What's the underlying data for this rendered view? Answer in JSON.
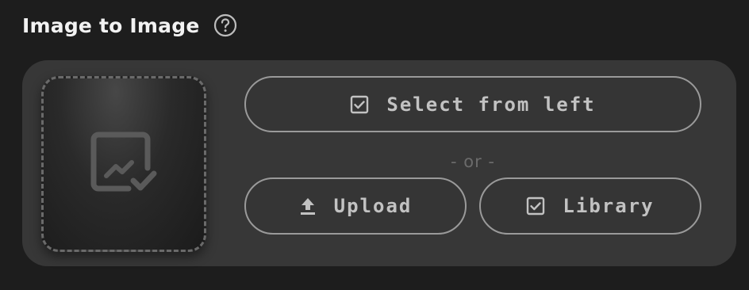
{
  "header": {
    "title": "Image to Image",
    "help_icon": "question-circle-icon"
  },
  "dropzone": {
    "icon": "image-check-icon"
  },
  "actions": {
    "select_from_left": {
      "label": "Select from left",
      "icon": "checkbox-checked-icon"
    },
    "or_separator": "- or -",
    "upload": {
      "label": "Upload",
      "icon": "upload-icon"
    },
    "library": {
      "label": "Library",
      "icon": "checkbox-checked-icon"
    }
  },
  "colors": {
    "background": "#1d1d1d",
    "panel": "#373737",
    "button_border": "#9a9a9a",
    "button_text": "#c2c2c2",
    "title_text": "#f2f2f2",
    "muted_text": "#6b6b6b"
  }
}
